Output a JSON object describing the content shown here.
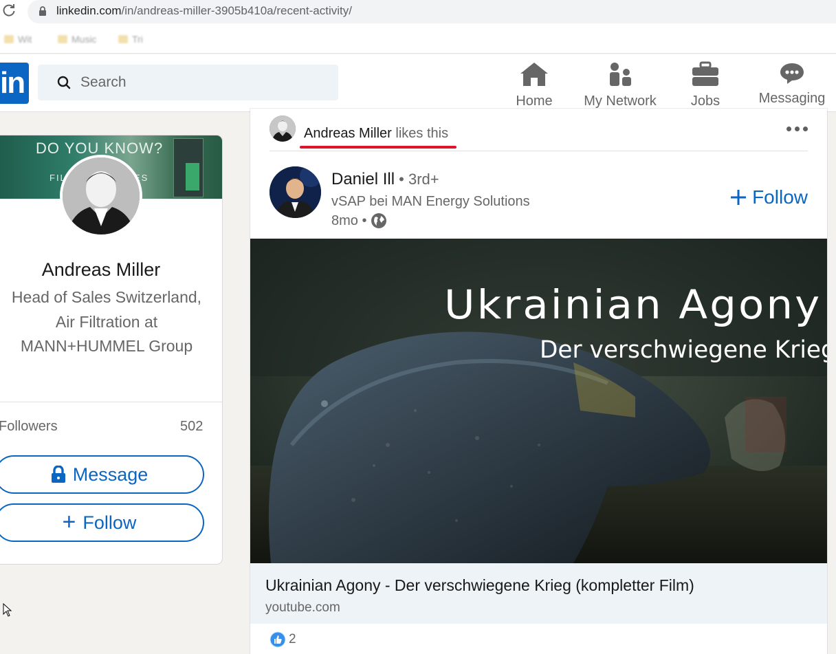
{
  "browser": {
    "url_host": "linkedin.com",
    "url_path": "/in/andreas-miller-3905b410a/recent-activity/",
    "bookmarks": [
      "Wit",
      "Music",
      "Tri"
    ]
  },
  "header": {
    "logo_text": "in",
    "search_placeholder": "Search",
    "nav": [
      {
        "label": "Home",
        "icon": "home-icon"
      },
      {
        "label": "My Network",
        "icon": "my-network-icon"
      },
      {
        "label": "Jobs",
        "icon": "briefcase-icon"
      },
      {
        "label": "Messaging",
        "icon": "messaging-icon"
      }
    ]
  },
  "profile": {
    "banner_text": "DO YOU KNOW?",
    "banner_sub_left": "FIL",
    "banner_sub_right": "ES",
    "name": "Andreas Miller",
    "headline": "Head of Sales Switzerland, Air Filtration at MANN+HUMMEL Group",
    "followers_label": "Followers",
    "followers_count": "502",
    "message_label": "Message",
    "follow_label": "Follow"
  },
  "post": {
    "activity_actor": "Andreas Miller",
    "activity_action": " likes this",
    "author_name": "Daniel Ill",
    "author_degree": " • 3rd+",
    "author_headline": "vSAP bei MAN Energy Solutions",
    "time": "8mo •",
    "follow_label": "Follow",
    "image_title": "Ukrainian Agony",
    "image_subtitle": "Der verschwiegene Krieg",
    "link_title": "Ukrainian Agony - Der verschwiegene Krieg (kompletter Film)",
    "link_source": "youtube.com",
    "reaction_count": "2",
    "colors": {
      "accent": "#0a66c2",
      "highlight_underline": "#d9162a"
    }
  }
}
